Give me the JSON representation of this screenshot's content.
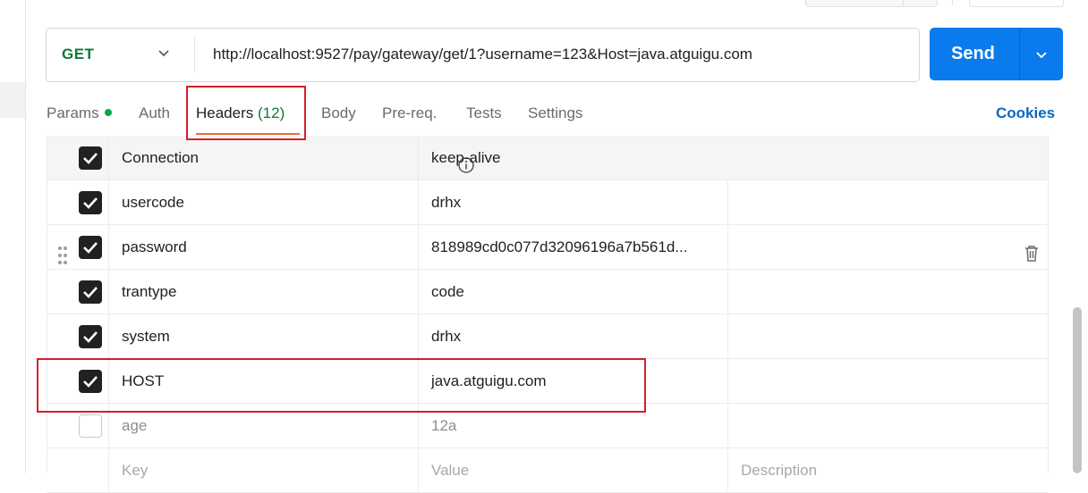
{
  "request": {
    "method": "GET",
    "url": "http://localhost:9527/pay/gateway/get/1?username=123&Host=java.atguigu.com",
    "send_label": "Send"
  },
  "tabs": [
    {
      "label": "Params",
      "has_dot": true
    },
    {
      "label": "Auth"
    },
    {
      "label": "Headers",
      "count": "(12)",
      "active": true
    },
    {
      "label": "Body"
    },
    {
      "label": "Pre-req."
    },
    {
      "label": "Tests"
    },
    {
      "label": "Settings"
    }
  ],
  "cookies_label": "Cookies",
  "headers": {
    "rows": [
      {
        "key": "Connection",
        "value": "keep-alive",
        "checked": true,
        "auto": true
      },
      {
        "key": "usercode",
        "value": "drhx",
        "checked": true
      },
      {
        "key": "password",
        "value": "818989cd0c077d32096196a7b561d...",
        "checked": true,
        "hovered": true
      },
      {
        "key": "trantype",
        "value": "code",
        "checked": true
      },
      {
        "key": "system",
        "value": "drhx",
        "checked": true
      },
      {
        "key": "HOST",
        "value": "java.atguigu.com",
        "checked": true,
        "highlighted": true
      },
      {
        "key": "age",
        "value": "12a",
        "checked": false
      }
    ],
    "placeholder": {
      "key": "Key",
      "value": "Value",
      "description": "Description"
    }
  },
  "colors": {
    "accent": "#097bed",
    "method_get": "#0d7a3a",
    "active_underline": "#f26b3a",
    "annotation": "#d32029",
    "link": "#0a66c2"
  }
}
